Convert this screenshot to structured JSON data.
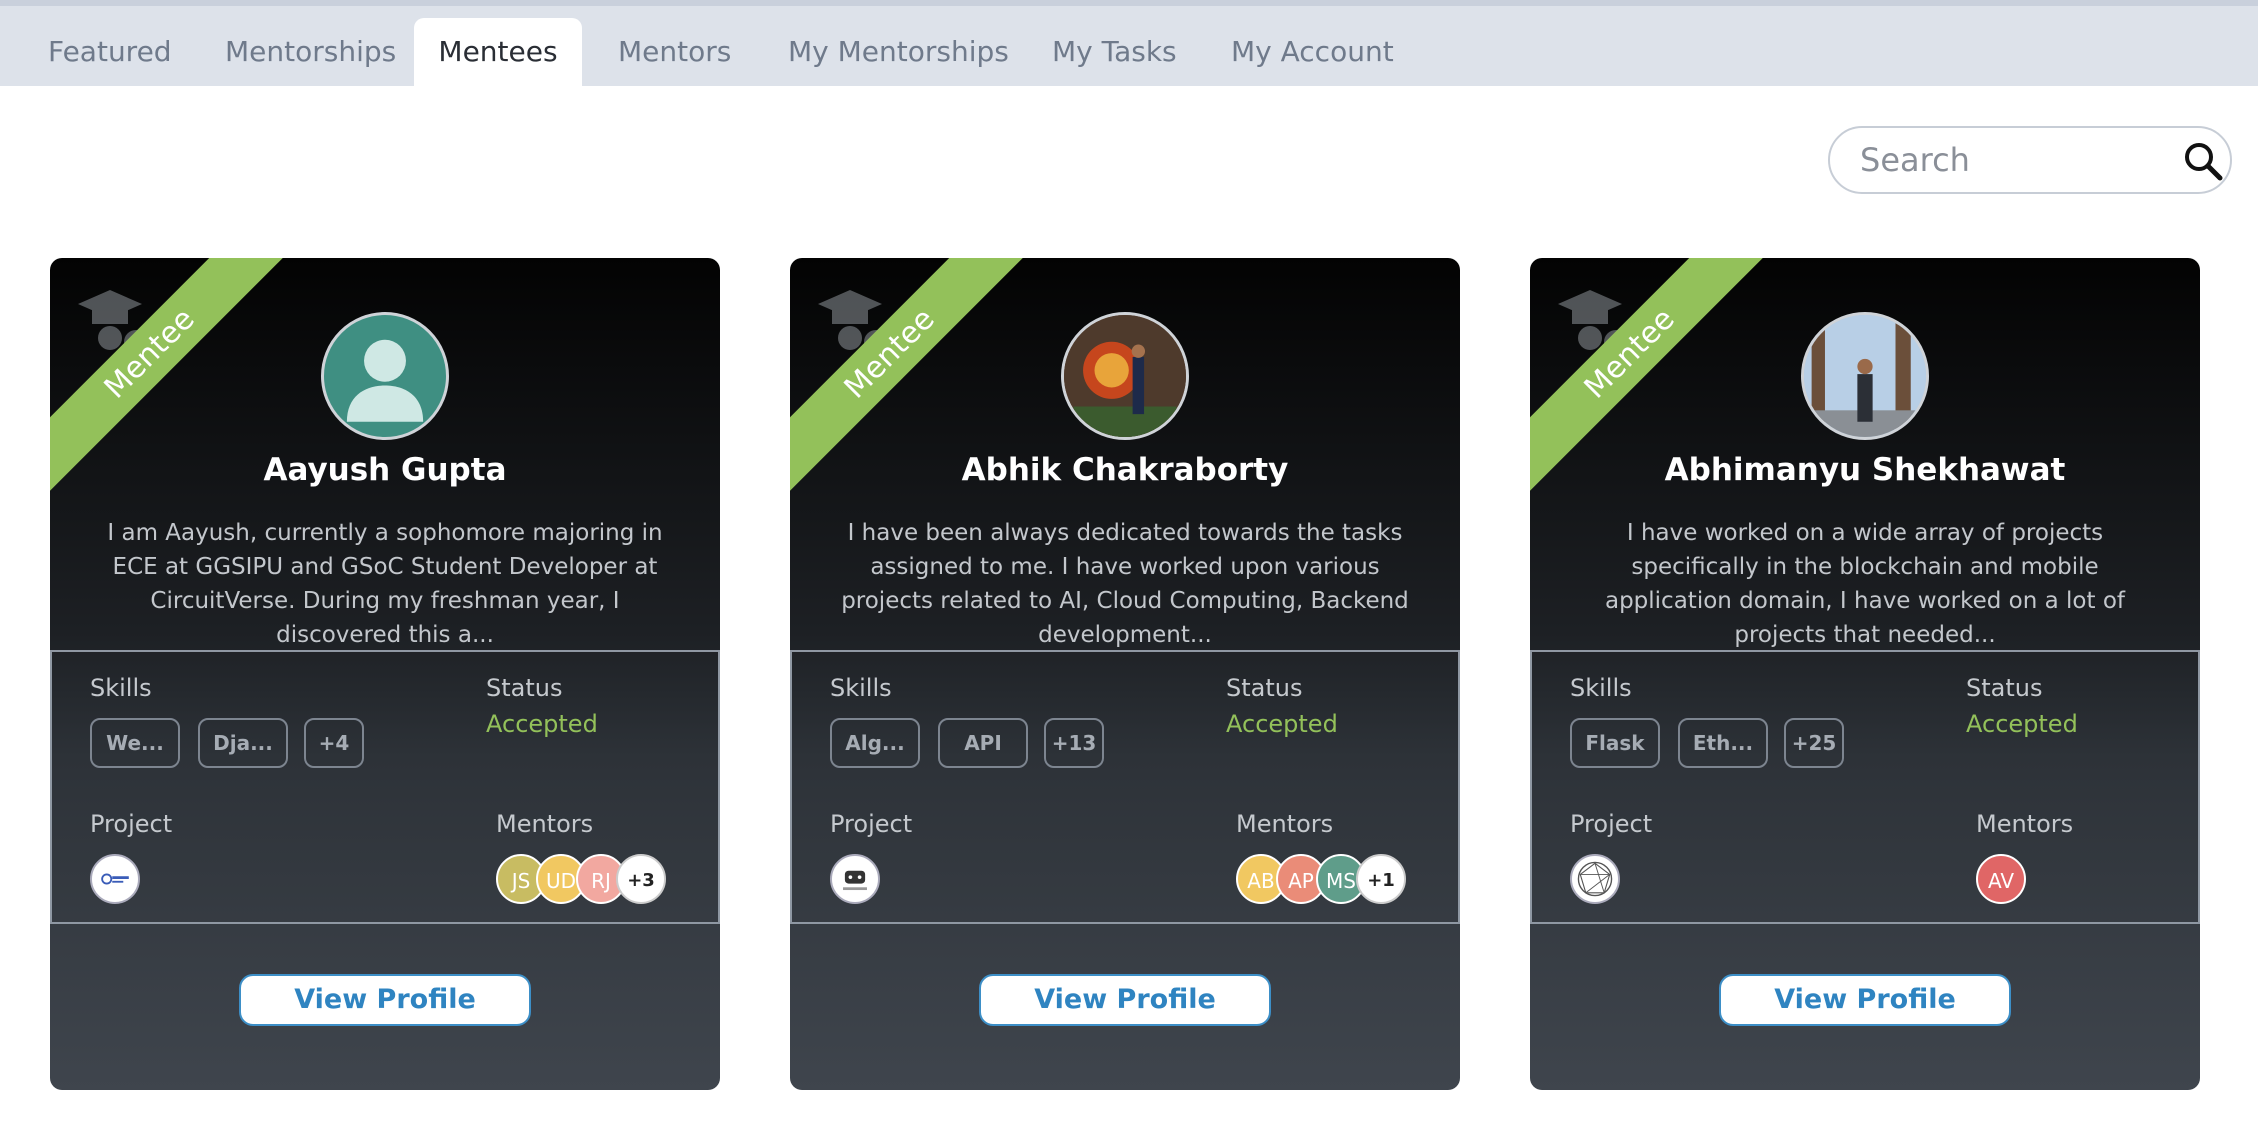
{
  "tabs": [
    "Featured",
    "Mentorships",
    "Mentees",
    "Mentors",
    "My Mentorships",
    "My Tasks",
    "My Account"
  ],
  "active_tab": "Mentees",
  "search": {
    "placeholder": "Search"
  },
  "card_labels": {
    "ribbon": "Mentee",
    "skills": "Skills",
    "status": "Status",
    "project": "Project",
    "mentors": "Mentors",
    "view_profile": "View Profile"
  },
  "mentees": [
    {
      "name": "Aayush Gupta",
      "bio": "I am Aayush, currently a sophomore majoring in ECE at GGSIPU and GSoC Student Developer at CircuitVerse. During my freshman year, I discovered this a...",
      "skills": [
        "We...",
        "Dja...",
        "+4"
      ],
      "status": "Accepted",
      "mentors": [
        "JS",
        "UD",
        "RJ",
        "+3"
      ]
    },
    {
      "name": "Abhik Chakraborty",
      "bio": "I have been always dedicated towards the tasks assigned to me. I have worked upon various projects related to AI, Cloud Computing, Backend development...",
      "skills": [
        "Alg...",
        "API",
        "+13"
      ],
      "status": "Accepted",
      "mentors": [
        "AB",
        "AP",
        "MS",
        "+1"
      ]
    },
    {
      "name": "Abhimanyu Shekhawat",
      "bio": "I have worked on a wide array of projects specifically in the blockchain and mobile application domain, I have worked on a lot of projects that needed...",
      "skills": [
        "Flask",
        "Eth...",
        "+25"
      ],
      "status": "Accepted",
      "mentors": [
        "AV"
      ]
    }
  ],
  "colors": {
    "accent_green": "#93c15a",
    "button_blue": "#2f84c1",
    "mentor_avatars": [
      "#c8bc62",
      "#f1c861",
      "#f2a8a0",
      "#f1c861",
      "#ea8c78",
      "#5f9d8a",
      "#e06666"
    ]
  }
}
